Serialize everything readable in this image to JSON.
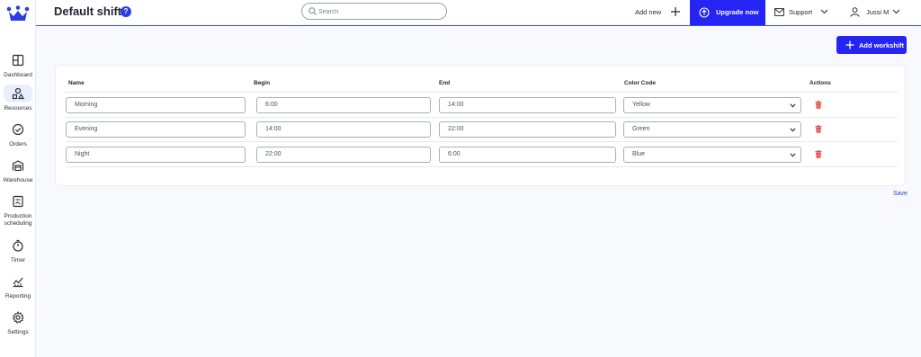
{
  "header": {
    "title": "Default shifts",
    "help_icon": "?",
    "search_placeholder": "Search",
    "add_new_label": "Add new",
    "upgrade_label": "Upgrade now",
    "support_label": "Support",
    "user_name": "Jussi M"
  },
  "sidebar": {
    "items": [
      {
        "label": "Dashboard",
        "icon": "dashboard-icon"
      },
      {
        "label": "Resources",
        "icon": "resources-icon",
        "active": true
      },
      {
        "label": "Orders",
        "icon": "check-circle-icon"
      },
      {
        "label": "Warehouse",
        "icon": "warehouse-icon"
      },
      {
        "label": "Production scheduling",
        "icon": "schedule-icon"
      },
      {
        "label": "Timer",
        "icon": "stopwatch-icon"
      },
      {
        "label": "Reporting",
        "icon": "chart-icon"
      },
      {
        "label": "Settings",
        "icon": "gear-icon"
      }
    ]
  },
  "main": {
    "add_workshift_label": "Add workshift",
    "save_label": "Save",
    "table": {
      "columns": [
        "Name",
        "Begin",
        "End",
        "Color Code",
        "Actions"
      ],
      "rows": [
        {
          "name": "Morning",
          "begin": "6:00",
          "end": "14:00",
          "color": "Yellow"
        },
        {
          "name": "Evening",
          "begin": "14:00",
          "end": "22:00",
          "color": "Green"
        },
        {
          "name": "Night",
          "begin": "22:00",
          "end": "6:00",
          "color": "Blue"
        }
      ]
    }
  },
  "colors": {
    "accent": "#2424f5",
    "danger": "#e53935"
  }
}
